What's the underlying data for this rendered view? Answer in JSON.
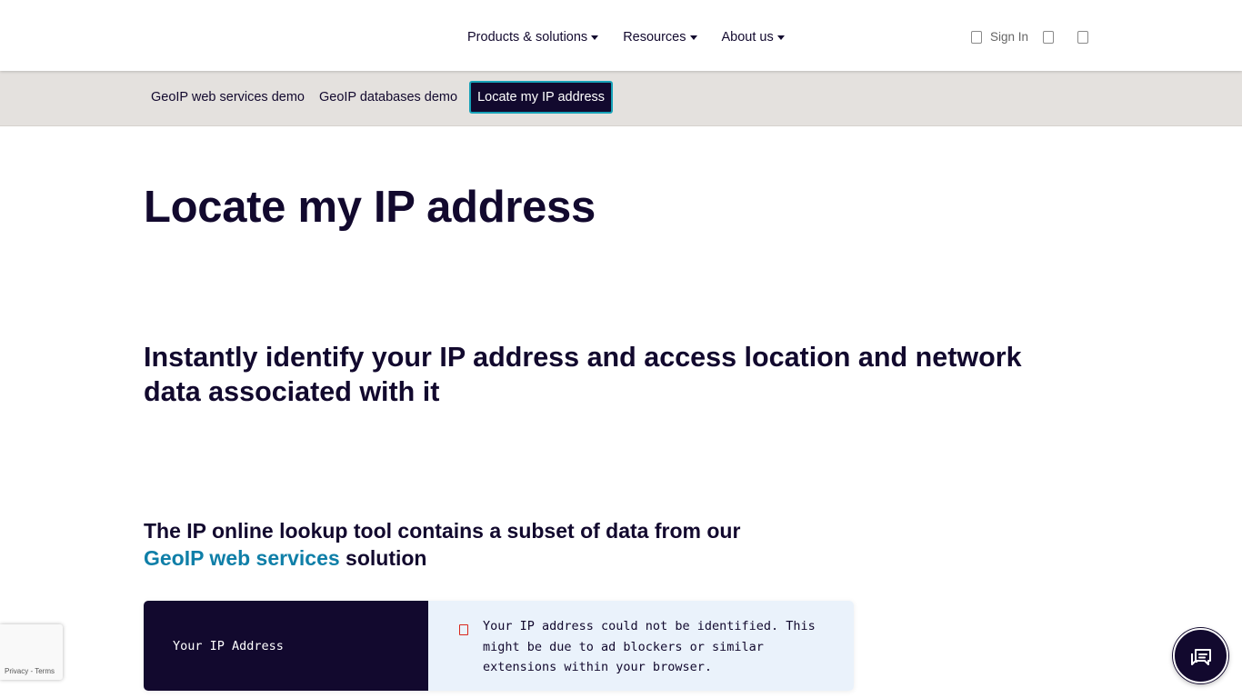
{
  "header": {
    "nav": [
      {
        "label": "Products & solutions"
      },
      {
        "label": "Resources"
      },
      {
        "label": "About us"
      }
    ],
    "sign_in_label": "Sign In",
    "icons": [
      "user-icon",
      "search-icon",
      "globe-icon"
    ]
  },
  "subnav": {
    "items": [
      {
        "label": "GeoIP web services demo"
      },
      {
        "label": "GeoIP databases demo"
      },
      {
        "label": "Locate my IP address",
        "active": true
      }
    ]
  },
  "main": {
    "title": "Locate my IP address",
    "subtitle": "Instantly identify your IP address and access location and network data associated with it",
    "note_prefix": "The IP online lookup tool contains a subset of data from our",
    "note_link": "GeoIP web services",
    "note_suffix": "solution"
  },
  "ip_card": {
    "label": "Your IP Address",
    "message": "Your IP address could not be identified. This might be due to ad blockers or similar extensions within your browser."
  },
  "recaptcha": {
    "privacy": "Privacy",
    "separator": "-",
    "terms": "Terms"
  },
  "colors": {
    "navy": "#12092e",
    "link": "#0f7fa8",
    "subnav_bg": "#e4e1de",
    "card_value_bg": "#eaf2fb",
    "active_border": "#17a2b8",
    "warning": "#d9261c"
  }
}
